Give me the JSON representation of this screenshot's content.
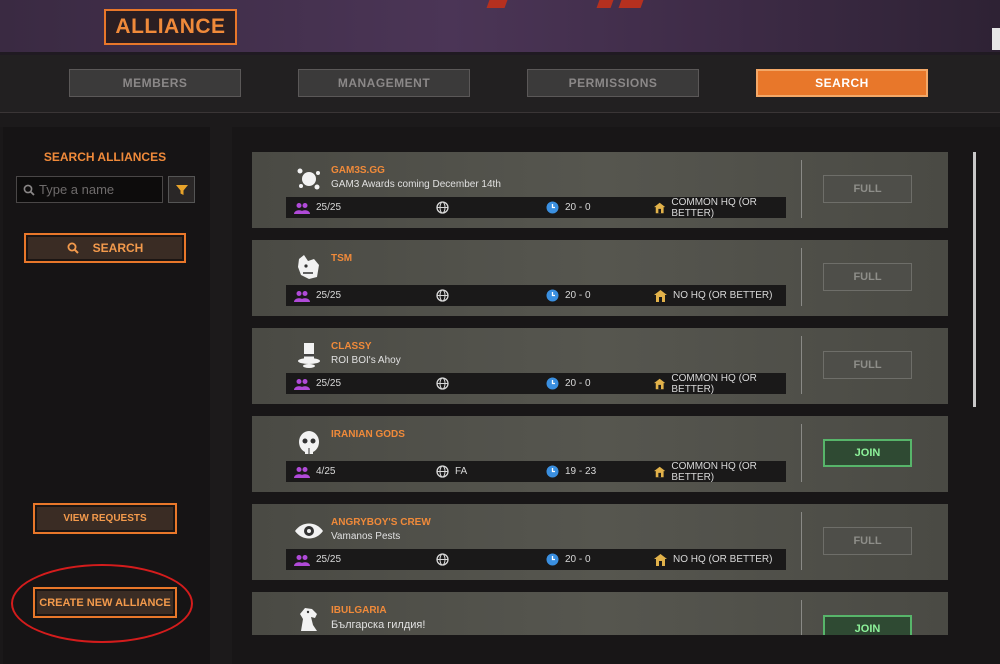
{
  "header": {
    "title": "ALLIANCE"
  },
  "tabs": [
    {
      "label": "MEMBERS",
      "active": false
    },
    {
      "label": "MANAGEMENT",
      "active": false
    },
    {
      "label": "PERMISSIONS",
      "active": false
    },
    {
      "label": "SEARCH",
      "active": true
    }
  ],
  "sidebar": {
    "search_title": "SEARCH ALLIANCES",
    "search_placeholder": "Type a name",
    "search_button": "SEARCH",
    "view_requests": "VIEW REQUESTS",
    "create_alliance": "CREATE NEW ALLIANCE"
  },
  "colors": {
    "accent": "#e8772a",
    "join_green": "#57b56a",
    "highlight_red": "#d41c1c",
    "members_purple": "#b04ad8",
    "clock_blue": "#3a8fe0",
    "hq_gold": "#e2b24a"
  },
  "alliances": [
    {
      "name": "GAM3S.GG",
      "motto": "GAM3 Awards coming December 14th",
      "members": "25/25",
      "region": "",
      "hours": "20 - 0",
      "hq": "COMMON HQ (OR BETTER)",
      "action": "FULL",
      "emblem": "splat-icon"
    },
    {
      "name": "TSM",
      "motto": "",
      "members": "25/25",
      "region": "",
      "hours": "20 - 0",
      "hq": "NO HQ (OR BETTER)",
      "action": "FULL",
      "emblem": "wolf-icon"
    },
    {
      "name": "CLASSY",
      "motto": "ROI BOI's Ahoy",
      "members": "25/25",
      "region": "",
      "hours": "20 - 0",
      "hq": "COMMON HQ (OR BETTER)",
      "action": "FULL",
      "emblem": "top-hat-icon"
    },
    {
      "name": "IRANIAN GODS",
      "motto": "",
      "members": "4/25",
      "region": "FA",
      "hours": "19 - 23",
      "hq": "COMMON HQ (OR BETTER)",
      "action": "JOIN",
      "emblem": "skull-icon"
    },
    {
      "name": "ANGRYBOY'S CREW",
      "motto": "Vamanos Pests",
      "members": "25/25",
      "region": "",
      "hours": "20 - 0",
      "hq": "NO HQ (OR BETTER)",
      "action": "FULL",
      "emblem": "eye-icon"
    },
    {
      "name": "IBULGARIA",
      "motto": "Българска гилдия!",
      "members": "",
      "region": "",
      "hours": "",
      "hq": "",
      "action": "JOIN",
      "emblem": "horse-icon"
    }
  ]
}
